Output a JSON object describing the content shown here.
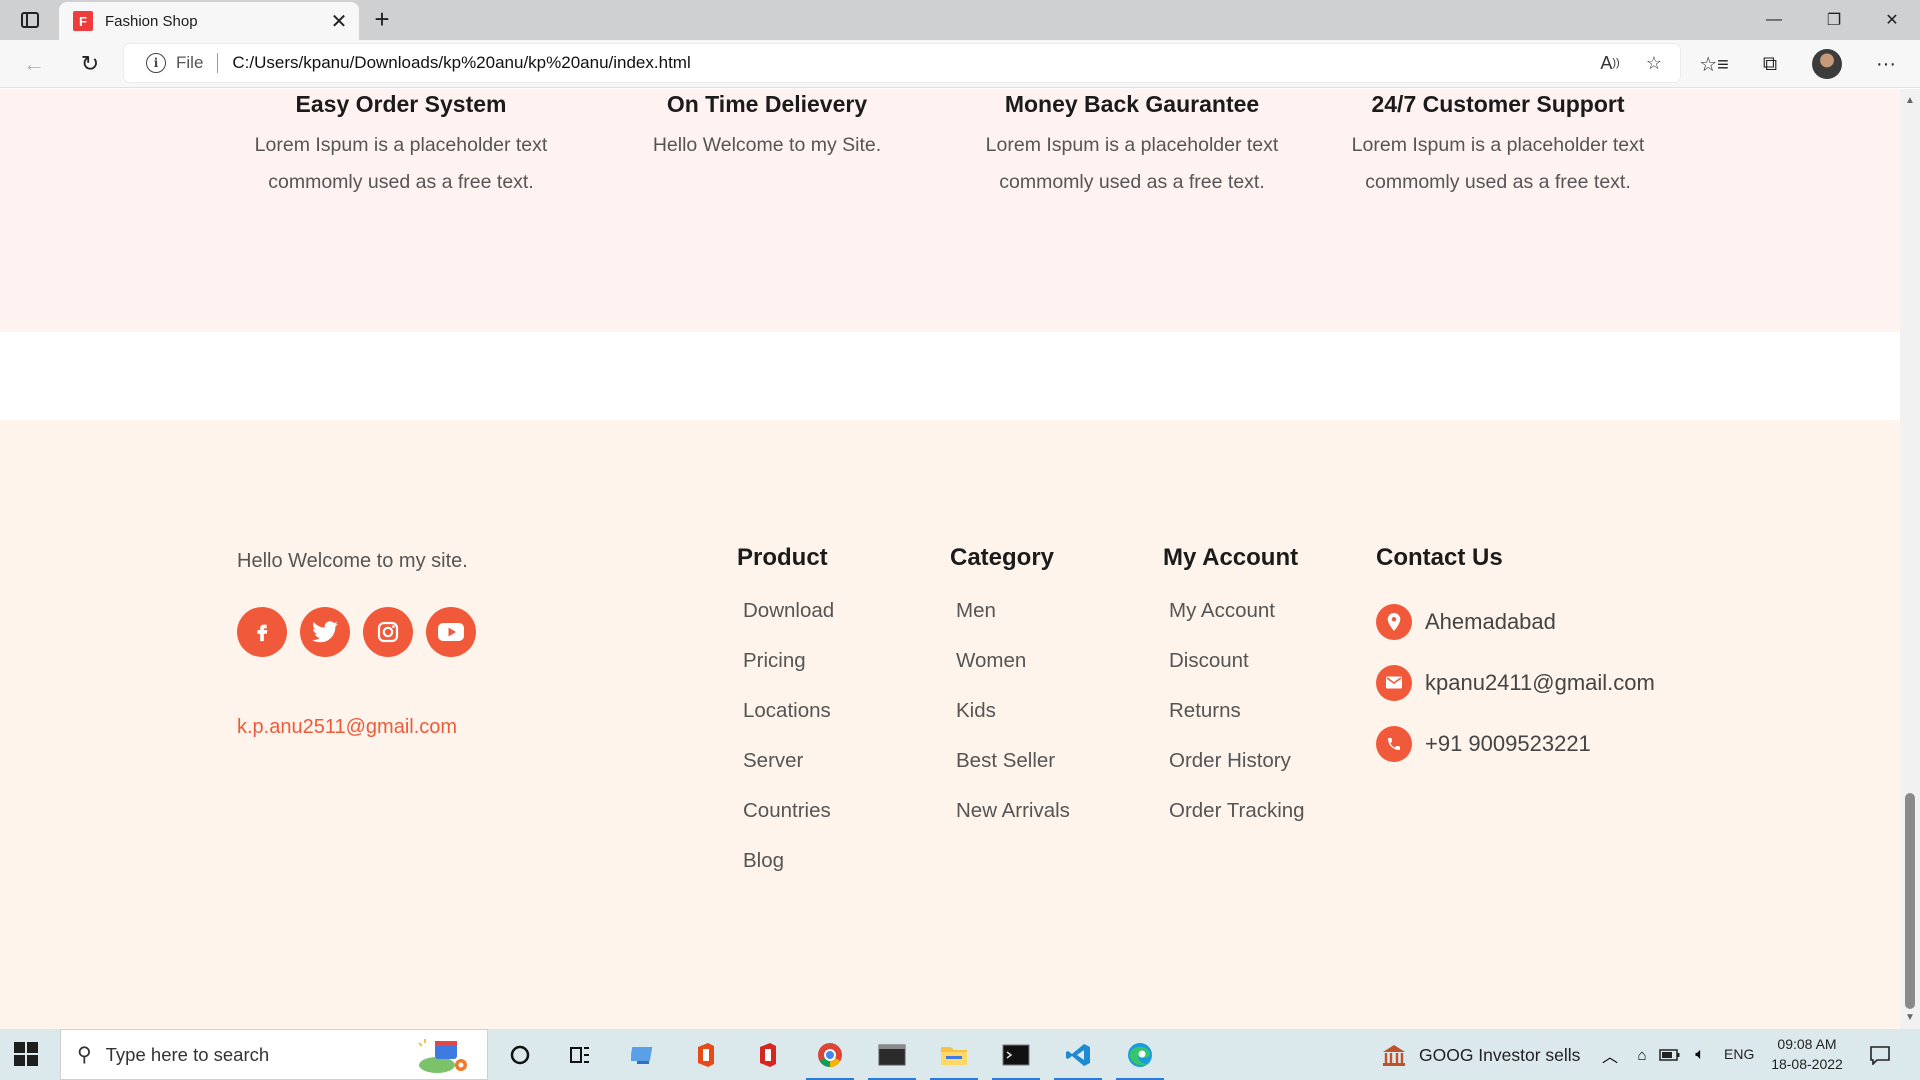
{
  "browser": {
    "tab_title": "Fashion Shop",
    "tab_favicon_letter": "F",
    "address_scheme_label": "File",
    "url": "C:/Users/kpanu/Downloads/kp%20anu/kp%20anu/index.html"
  },
  "features": [
    {
      "title": "Easy Order System",
      "text_line1": "Lorem Ispum is a placeholder text",
      "text_line2": "commomly used as a free text."
    },
    {
      "title": "On Time Delievery",
      "text_line1": "Hello Welcome to my Site.",
      "text_line2": ""
    },
    {
      "title": "Money Back Gaurantee",
      "text_line1": "Lorem Ispum is a placeholder text",
      "text_line2": "commomly used as a free text."
    },
    {
      "title": "24/7 Customer Support",
      "text_line1": "Lorem Ispum is a placeholder text",
      "text_line2": "commomly used as a free text."
    }
  ],
  "footer": {
    "welcome": "Hello Welcome to my site.",
    "email": "k.p.anu2511@gmail.com",
    "social_icons": [
      "facebook-icon",
      "twitter-icon",
      "instagram-icon",
      "youtube-icon"
    ],
    "product": {
      "heading": "Product",
      "items": [
        "Download",
        "Pricing",
        "Locations",
        "Server",
        "Countries",
        "Blog"
      ]
    },
    "category": {
      "heading": "Category",
      "items": [
        "Men",
        "Women",
        "Kids",
        "Best Seller",
        "New Arrivals"
      ]
    },
    "account": {
      "heading": "My Account",
      "items": [
        "My Account",
        "Discount",
        "Returns",
        "Order History",
        "Order Tracking"
      ]
    },
    "contact": {
      "heading": "Contact Us",
      "location": "Ahemadabad",
      "email": "kpanu2411@gmail.com",
      "phone": "+91 9009523221"
    }
  },
  "taskbar": {
    "search_placeholder": "Type here to search",
    "news_ticker": "GOOG  Investor sells",
    "language": "ENG",
    "time": "09:08 AM",
    "date": "18-08-2022"
  },
  "colors": {
    "accent": "#f05a3a",
    "features_bg": "#fff3f1",
    "footer_bg": "#fff4ec"
  }
}
